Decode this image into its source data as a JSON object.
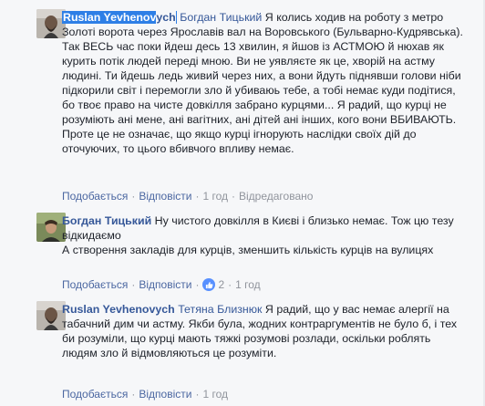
{
  "comments": [
    {
      "author_first": "Ruslan Yevhenov",
      "author_rest": "ych",
      "mention": "Богдан Тицький",
      "body": " Я колись ходив на роботу з метро Золоті ворота через Ярославів вал на Воровського (Бульварно-Кудрявська). Так ВЕСЬ час поки йдеш десь 13 хвилин, я йшов із АСТМОЮ й нюхав як курить потік людей переді мною. Ви не уявляєте як це, хворій на астму людині. Ти йдешь ледь живий через них, а вони йдуть піднявши голови ніби підкорили світ і перемогли зло й убиваюь тебе, а тобі немає куди подітися, бо твоє право на чисте довкілля забрано курцями... Я радий, що курці не розуміють ані мене, ані вагітних, ані дітей ані інших, кого вони ВБИВАЮТЬ. Проте це не означає, що якщо курці ігнорують наслідки своїх дій до оточуючих, то цього вбивчого впливу немає.",
      "actions": {
        "like": "Подобається",
        "reply": "Відповісти",
        "time": "1 год",
        "edited": "Відредаговано"
      }
    },
    {
      "author": "Богдан Тицький",
      "body1": " Ну чистого довкілля в Києві і близько немає. Тож цю тезу відкидаємо",
      "body2": "А створення закладів для курців, зменшить кількість курців на вулицях",
      "actions": {
        "like": "Подобається",
        "reply": "Відповісти",
        "reactions": "2",
        "time": "1 год"
      }
    },
    {
      "author": "Ruslan Yevhenovych",
      "mention": "Тетяна Близнюк",
      "body": " Я радий, що у вас немає алергії на табачний дим чи астму. Якби була, жодних контраргументів не було б, і тех би розуміли, що курці мають тяжкі розумові розлади, оскільки роблять людям зло й відмовляються це розуміти.",
      "actions": {
        "like": "Подобається",
        "reply": "Відповісти",
        "time": "1 год"
      }
    }
  ],
  "separator": "·",
  "colors": {
    "link": "#365899",
    "action": "#4b67a1",
    "muted": "#90949c",
    "like_badge": "#5890ff"
  }
}
